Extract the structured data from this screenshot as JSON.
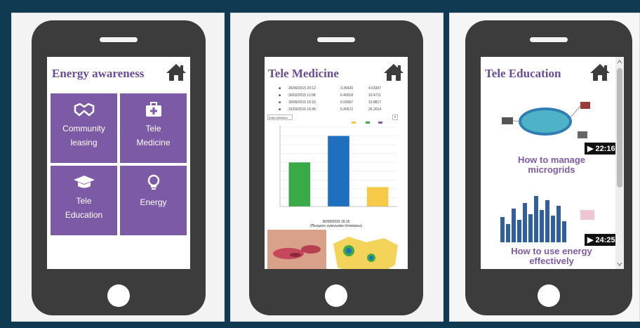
{
  "phone1": {
    "title": "Energy awareness",
    "tiles": [
      {
        "label_lines": [
          "Community",
          "leasing"
        ],
        "icon": "handshake-icon"
      },
      {
        "label_lines": [
          "Tele",
          "Medicine"
        ],
        "icon": "medical-kit-icon"
      },
      {
        "label_lines": [
          "Tele",
          "Education"
        ],
        "icon": "graduation-cap-icon"
      },
      {
        "label_lines": [
          "Energy"
        ],
        "icon": "lightbulb-icon"
      }
    ]
  },
  "phone2": {
    "title": "Tele Medicine",
    "table_rows": [
      [
        "26/09/2015 20:12",
        "3.39420",
        "4.03307"
      ],
      [
        "30/02/2015 11:58",
        "6.40018",
        "10.4711"
      ],
      [
        "30/09/2015 16:15",
        "6.59367",
        "10.8817"
      ],
      [
        "31/03/2015 16:45",
        "6.40572",
        "26.2014"
      ]
    ],
    "table_button": "Index selection",
    "chart_caption_line1": "30/09/2015 16:15",
    "chart_caption_line2": "(Πιεσμενο υγιεινωσκο Ιπτασκαιω)"
  },
  "phone3": {
    "title": "Tele Education",
    "videos": [
      {
        "duration": "▶ 22:16",
        "caption_lines": [
          "How to manage",
          "microgrids"
        ]
      },
      {
        "duration": "▶ 24:25",
        "caption_lines": [
          "How to use energy",
          "effectively"
        ]
      }
    ],
    "scroll_up": "^",
    "scroll_down": "v"
  },
  "colors": {
    "background": "#0f3a52",
    "phone_body": "#3c3c3c",
    "tile_purple": "#7d5aa6",
    "title_purple": "#6a4a9c",
    "bar_green": "#3aaa47",
    "bar_blue": "#1f6fbf",
    "bar_yellow": "#f7c948"
  },
  "chart_data": {
    "type": "bar",
    "categories": [
      "",
      "",
      ""
    ],
    "values": [
      50,
      80,
      22
    ],
    "colors": [
      "#3aaa47",
      "#1f6fbf",
      "#f7c948"
    ],
    "ylim": [
      0,
      90
    ],
    "title": "",
    "xlabel": "",
    "ylabel": "",
    "grid": true
  }
}
